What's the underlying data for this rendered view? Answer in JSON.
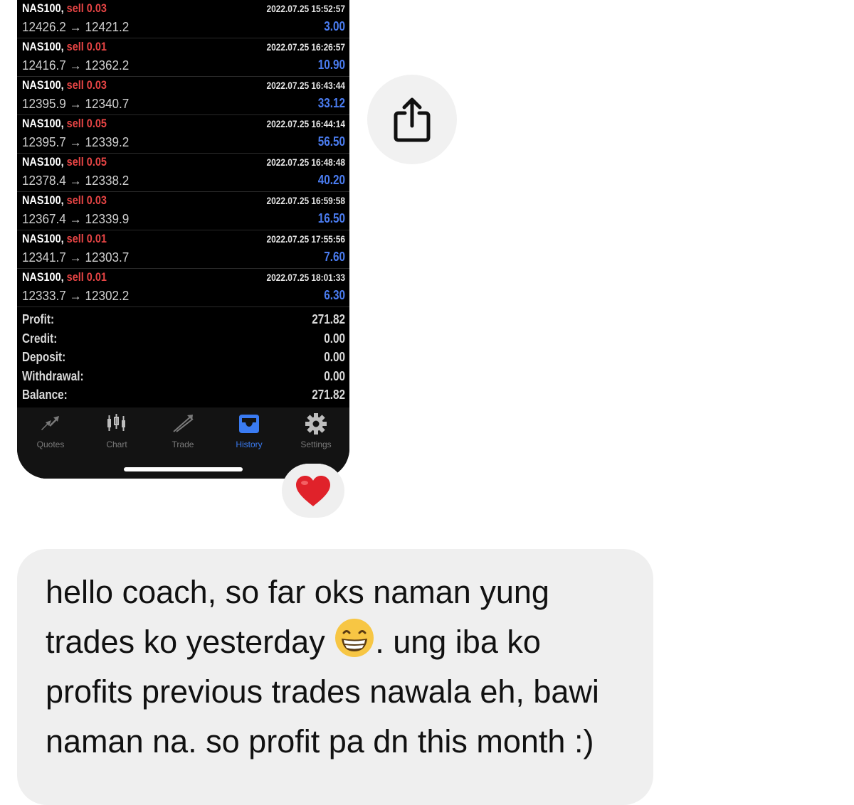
{
  "trades": [
    {
      "symbol": "NAS100,",
      "side": "sell",
      "volume": "0.03",
      "time": "2022.07.25 15:52:57",
      "open": "12426.2",
      "arrow": "→",
      "close": "12421.2",
      "profit": "3.00"
    },
    {
      "symbol": "NAS100,",
      "side": "sell",
      "volume": "0.01",
      "time": "2022.07.25 16:26:57",
      "open": "12416.7",
      "arrow": "→",
      "close": "12362.2",
      "profit": "10.90"
    },
    {
      "symbol": "NAS100,",
      "side": "sell",
      "volume": "0.03",
      "time": "2022.07.25 16:43:44",
      "open": "12395.9",
      "arrow": "→",
      "close": "12340.7",
      "profit": "33.12"
    },
    {
      "symbol": "NAS100,",
      "side": "sell",
      "volume": "0.05",
      "time": "2022.07.25 16:44:14",
      "open": "12395.7",
      "arrow": "→",
      "close": "12339.2",
      "profit": "56.50"
    },
    {
      "symbol": "NAS100,",
      "side": "sell",
      "volume": "0.05",
      "time": "2022.07.25 16:48:48",
      "open": "12378.4",
      "arrow": "→",
      "close": "12338.2",
      "profit": "40.20"
    },
    {
      "symbol": "NAS100,",
      "side": "sell",
      "volume": "0.03",
      "time": "2022.07.25 16:59:58",
      "open": "12367.4",
      "arrow": "→",
      "close": "12339.9",
      "profit": "16.50"
    },
    {
      "symbol": "NAS100,",
      "side": "sell",
      "volume": "0.01",
      "time": "2022.07.25 17:55:56",
      "open": "12341.7",
      "arrow": "→",
      "close": "12303.7",
      "profit": "7.60"
    },
    {
      "symbol": "NAS100,",
      "side": "sell",
      "volume": "0.01",
      "time": "2022.07.25 18:01:33",
      "open": "12333.7",
      "arrow": "→",
      "close": "12302.2",
      "profit": "6.30"
    }
  ],
  "summary": [
    {
      "label": "Profit:",
      "value": "271.82"
    },
    {
      "label": "Credit:",
      "value": "0.00"
    },
    {
      "label": "Deposit:",
      "value": "0.00"
    },
    {
      "label": "Withdrawal:",
      "value": "0.00"
    },
    {
      "label": "Balance:",
      "value": "271.82"
    }
  ],
  "tabs": [
    {
      "label": "Quotes",
      "icon": "quotes-icon"
    },
    {
      "label": "Chart",
      "icon": "chart-icon"
    },
    {
      "label": "Trade",
      "icon": "trade-icon"
    },
    {
      "label": "History",
      "icon": "history-icon",
      "active": true
    },
    {
      "label": "Settings",
      "icon": "settings-icon"
    }
  ],
  "colors": {
    "sell": "#e84545",
    "profit": "#4a7cf0",
    "active_tab": "#3a7bf2",
    "bubble": "#efefef"
  },
  "share": {
    "icon": "share-icon"
  },
  "reaction": {
    "icon": "heart-icon"
  },
  "message": {
    "part1": "hello coach, so far oks naman yung trades ko yesterday ",
    "emoji": "grinning-face-icon",
    "part2": ". ung iba ko profits previous trades nawala eh, bawi naman na. so profit pa dn this month :)"
  }
}
